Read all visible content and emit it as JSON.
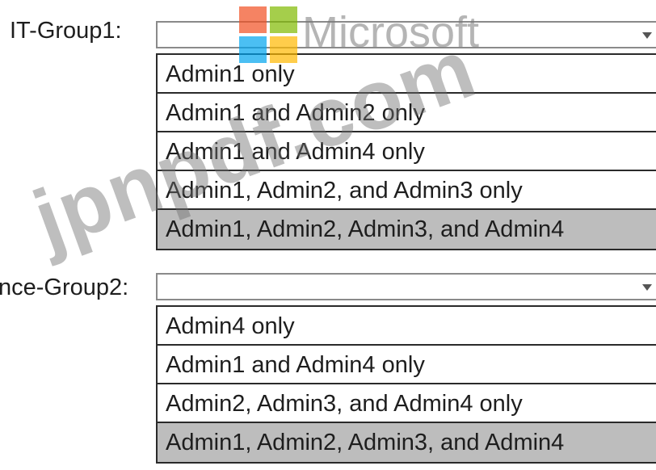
{
  "groups": [
    {
      "label": "IT-Group1:",
      "selected_value": "",
      "options": [
        "Admin1 only",
        "Admin1 and Admin2 only",
        "Admin1 and Admin4 only",
        "Admin1, Admin2, and Admin3 only",
        "Admin1, Admin2, Admin3, and Admin4"
      ],
      "highlighted_index": 4
    },
    {
      "label": "nce-Group2:",
      "selected_value": "",
      "options": [
        "Admin4 only",
        "Admin1 and Admin4 only",
        "Admin2, Admin3, and Admin4 only",
        "Admin1, Admin2, Admin3, and Admin4"
      ],
      "highlighted_index": 3
    }
  ],
  "watermarks": {
    "brand": "Microsoft",
    "site": "jpnpdf.com",
    "logo_colors": [
      "#f25022",
      "#7fba00",
      "#00a4ef",
      "#ffb900"
    ]
  },
  "colors": {
    "highlight": "#bdbdbd",
    "border": "#2a2a2a"
  }
}
